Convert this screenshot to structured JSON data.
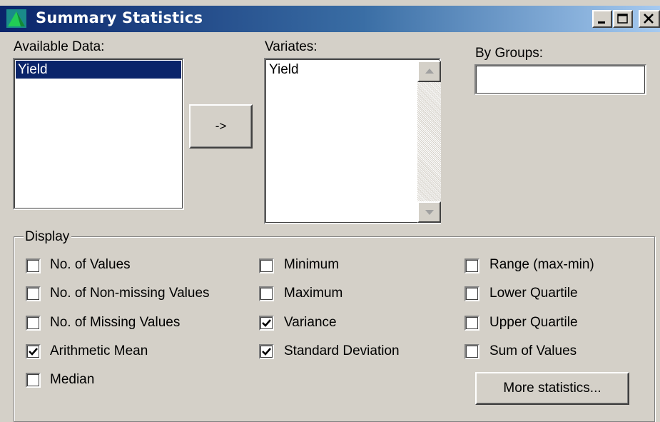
{
  "window": {
    "title": "Summary Statistics",
    "app_icon": "chart-triangle-icon",
    "controls": [
      "minimize-icon",
      "maximize-icon",
      "close-icon"
    ]
  },
  "available_data": {
    "label": "Available Data:",
    "items": [
      {
        "label": "Yield",
        "selected": true
      }
    ]
  },
  "transfer_button": {
    "label": "->"
  },
  "variates": {
    "label": "Variates:",
    "items": [
      {
        "label": "Yield"
      }
    ]
  },
  "by_groups": {
    "label": "By Groups:",
    "value": ""
  },
  "display": {
    "legend": "Display",
    "options": [
      {
        "label": "No. of Values",
        "checked": false
      },
      {
        "label": "No. of Non-missing Values",
        "checked": false
      },
      {
        "label": "No. of Missing Values",
        "checked": false
      },
      {
        "label": "Arithmetic Mean",
        "checked": true
      },
      {
        "label": "Median",
        "checked": false
      },
      {
        "label": "Minimum",
        "checked": false
      },
      {
        "label": "Maximum",
        "checked": false
      },
      {
        "label": "Variance",
        "checked": true
      },
      {
        "label": "Standard Deviation",
        "checked": true
      },
      {
        "label": "Range (max-min)",
        "checked": false
      },
      {
        "label": "Lower Quartile",
        "checked": false
      },
      {
        "label": "Upper Quartile",
        "checked": false
      },
      {
        "label": "Sum of Values",
        "checked": false
      }
    ],
    "more_button": "More statistics..."
  },
  "colors": {
    "titlebar_start": "#0a246a",
    "titlebar_end": "#a6caf0",
    "face": "#d4d0c8",
    "selection": "#0a246a"
  }
}
